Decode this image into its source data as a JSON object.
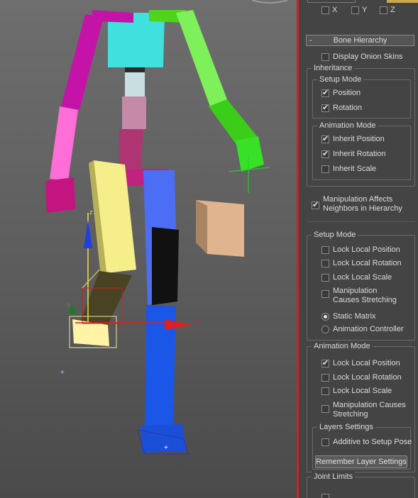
{
  "axes_row": {
    "x": "X",
    "y": "Y",
    "z": "Z"
  },
  "rollout": {
    "toggle": "-",
    "title": "Bone Hierarchy"
  },
  "display_onion_skins": {
    "label": "Display Onion Skins",
    "checked": false
  },
  "inheritance": {
    "title": "Inheritance",
    "setup_mode": {
      "title": "Setup Mode",
      "position": {
        "label": "Position",
        "checked": true
      },
      "rotation": {
        "label": "Rotation",
        "checked": true
      }
    },
    "animation_mode": {
      "title": "Animation Mode",
      "inherit_position": {
        "label": "Inherit Position",
        "checked": true
      },
      "inherit_rotation": {
        "label": "Inherit Rotation",
        "checked": true
      },
      "inherit_scale": {
        "label": "Inherit Scale",
        "checked": false
      }
    }
  },
  "manipulation_affects": {
    "line1": "Manipulation Affects",
    "line2": "Neighbors in Hierarchy",
    "checked": true
  },
  "setup_mode": {
    "title": "Setup Mode",
    "lock_local_position": {
      "label": "Lock Local Position",
      "checked": false
    },
    "lock_local_rotation": {
      "label": "Lock Local Rotation",
      "checked": false
    },
    "lock_local_scale": {
      "label": "Lock Local Scale",
      "checked": false
    },
    "manipulation_stretching": {
      "line1": "Manipulation",
      "line2": "Causes Stretching",
      "checked": false
    },
    "static_matrix": {
      "label": "Static Matrix",
      "selected": true
    },
    "animation_controller": {
      "label": "Animation Controller",
      "selected": false
    }
  },
  "animation_mode": {
    "title": "Animation Mode",
    "lock_local_position": {
      "label": "Lock Local Position",
      "checked": true
    },
    "lock_local_rotation": {
      "label": "Lock Local Rotation",
      "checked": false
    },
    "lock_local_scale": {
      "label": "Lock Local Scale",
      "checked": false
    },
    "manipulation_stretching": {
      "line1": "Manipulation Causes",
      "line2": "Stretching",
      "checked": false
    },
    "layers": {
      "title": "Layers Settings",
      "additive": {
        "label": "Additive to Setup Pose",
        "checked": false
      },
      "remember_button": "Remember Layer Settings"
    }
  },
  "joint_limits": {
    "title": "Joint Limits"
  },
  "gizmo": {
    "x_label": "x",
    "y_label": "y",
    "z_label": "z"
  },
  "colors": {
    "selection_red": "#c2262c",
    "panel_bg": "#444444"
  }
}
